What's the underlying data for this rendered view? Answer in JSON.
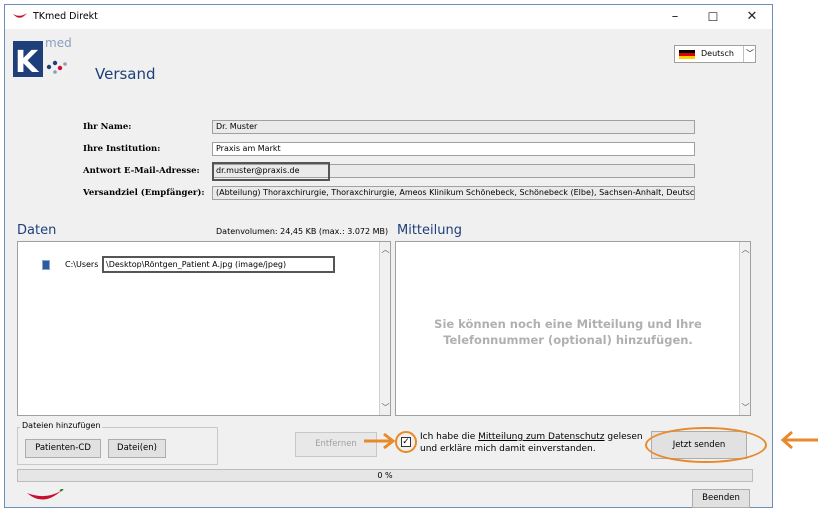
{
  "window": {
    "title": "TKmed Direkt",
    "minimize": "–",
    "maximize": "☐",
    "close": "✕"
  },
  "header": {
    "logo_letters": "TK",
    "logo_superscript": "med",
    "title": "Versand",
    "language": "Deutsch"
  },
  "form": {
    "name_label": "Ihr Name:",
    "name_value": "Dr. Muster",
    "institution_label": "Ihre Institution:",
    "institution_value": "Praxis am Markt",
    "email_label": "Antwort E-Mail-Adresse:",
    "email_value": "dr.muster@praxis.de",
    "target_label": "Versandziel (Empfänger):",
    "target_value": "(Abteilung) Thoraxchirurgie, Thoraxchirurgie, Ameos Klinikum Schönebeck, Schönebeck (Elbe), Sachsen-Anhalt, Deutschland"
  },
  "daten": {
    "title": "Daten",
    "volume": "Datenvolumen: 24,45 KB (max.: 3.072 MB)",
    "files": [
      {
        "path_prefix": "C:\\Users",
        "path_rest": "\\Desktop\\Röntgen_Patient A.jpg  (image/jpeg)"
      }
    ],
    "add_group_label": "Dateien hinzufügen",
    "patienten_cd": "Patienten-CD",
    "dateien": "Datei(en)",
    "entfernen": "Entfernen"
  },
  "mitteilung": {
    "title": "Mitteilung",
    "placeholder_line1": "Sie können noch eine Mitteilung und Ihre",
    "placeholder_line2": "Telefonnummer (optional) hinzufügen."
  },
  "consent": {
    "text_before": "Ich habe die ",
    "link": "Mitteilung zum Datenschutz",
    "text_after": " gelesen",
    "line2": "und erkläre mich damit einverstanden.",
    "checked": true
  },
  "send_button": "Jetzt senden",
  "progress": {
    "label": "0 %",
    "value": 0
  },
  "beenden": "Beenden",
  "colors": {
    "accent_blue": "#1f3f7a",
    "annotation_orange": "#e8892b",
    "logo_red": "#c8102e"
  }
}
